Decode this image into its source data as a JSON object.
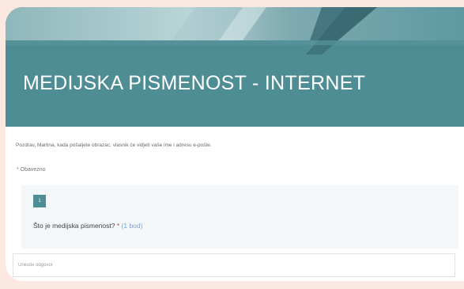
{
  "form": {
    "title": "MEDIJSKA PISMENOST - INTERNET",
    "info_line": "Pozdrav, Martina, kada pošaljete obrazac, vlasnik će vidjeti vaše ime i adresu e-pošte.",
    "required_note": "* Obavezno"
  },
  "question": {
    "number": "1",
    "text": "Što je medijska pismenost?",
    "required_star": "*",
    "points": "(1 bod)"
  },
  "answer": {
    "placeholder": "Unesite odgovor"
  },
  "colors": {
    "theme": "#4f8d95",
    "page_background": "#fbe8e0",
    "question_background": "#f3f7f9"
  }
}
